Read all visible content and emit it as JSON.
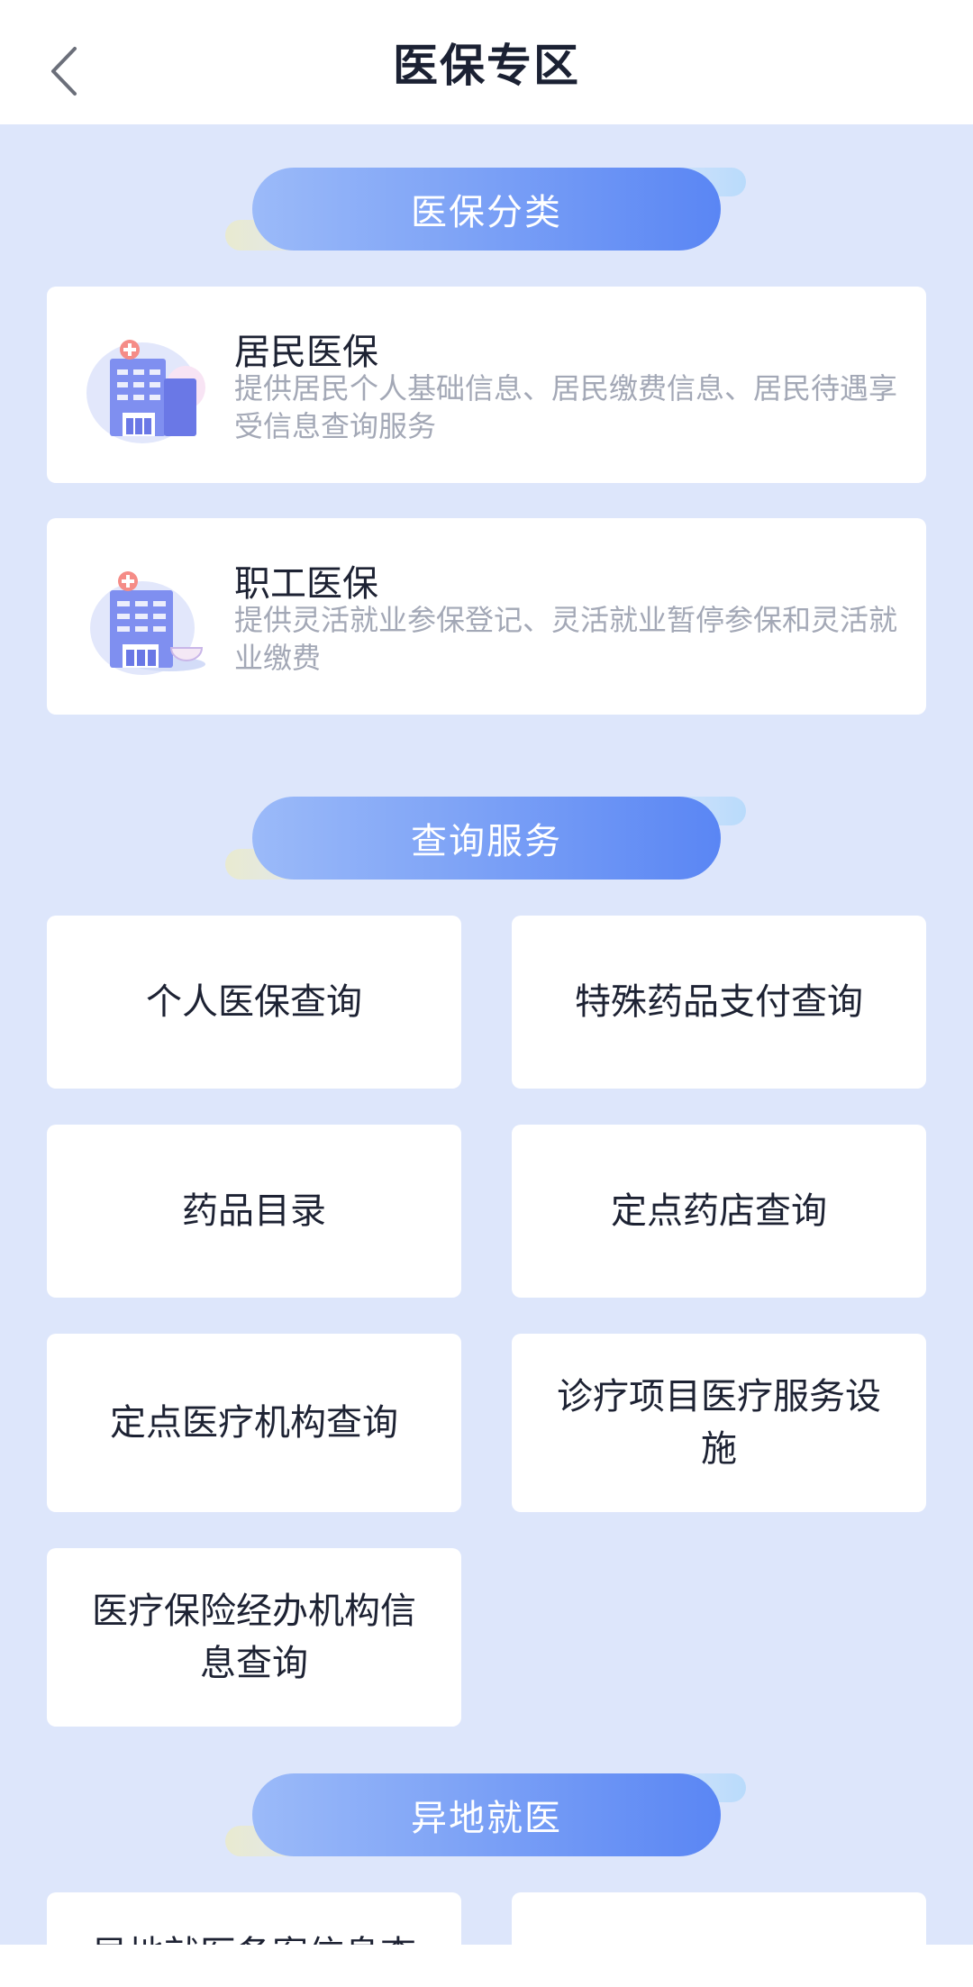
{
  "header": {
    "title": "医保专区"
  },
  "sections": {
    "category": "医保分类",
    "query": "查询服务",
    "remote": "异地就医"
  },
  "categories": [
    {
      "title": "居民医保",
      "desc": "提供居民个人基础信息、居民缴费信息、居民待遇享受信息查询服务"
    },
    {
      "title": "职工医保",
      "desc": "提供灵活就业参保登记、灵活就业暂停参保和灵活就业缴费"
    }
  ],
  "query_tiles": [
    "个人医保查询",
    "特殊药品支付查询",
    "药品目录",
    "定点药店查询",
    "定点医疗机构查询",
    "诊疗项目医疗服务设施",
    "医疗保险经办机构信息查询"
  ],
  "remote_tiles": [
    "异地就医备案信息查",
    ""
  ],
  "colors": {
    "background": "#dde6fb",
    "pill_start": "#9bbaf9",
    "pill_end": "#5a86f4",
    "card": "#ffffff",
    "title_text": "#1d2233",
    "desc_text": "#a3a8b6"
  }
}
